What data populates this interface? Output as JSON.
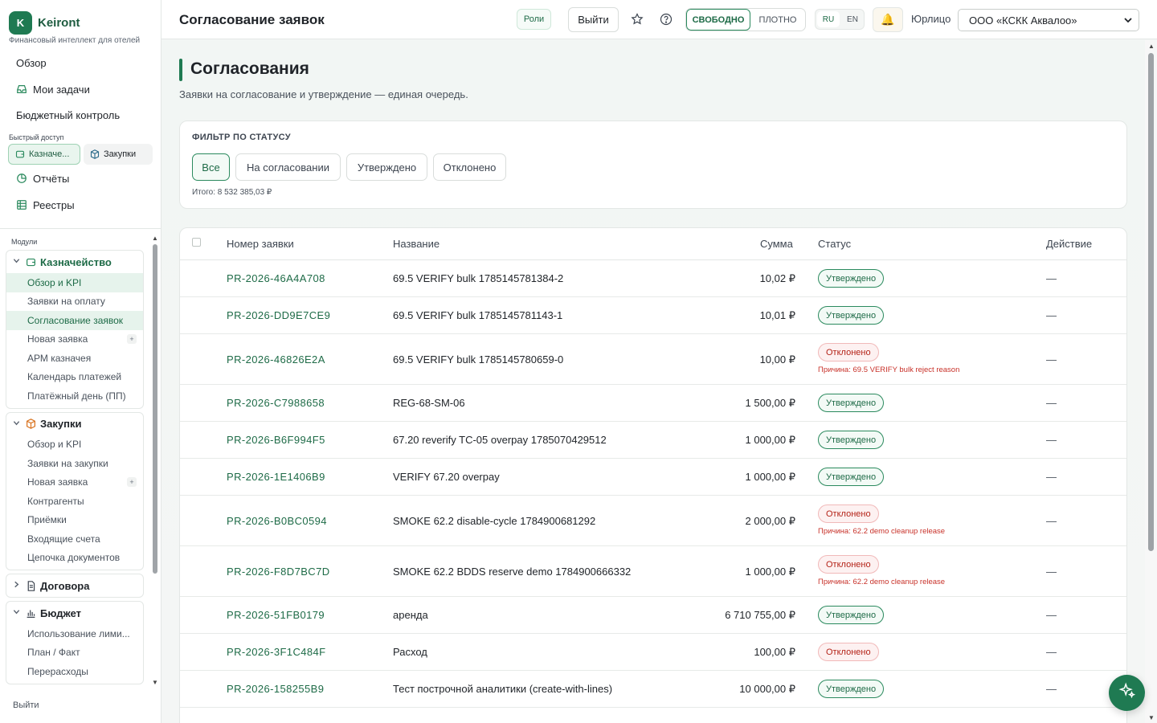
{
  "brand": {
    "logo_letter": "K",
    "name": "Keiront",
    "tagline": "Финансовый интеллект для отелей"
  },
  "sidebar": {
    "nav": [
      {
        "label": "Обзор",
        "icon": ""
      },
      {
        "label": "Мои задачи",
        "icon": "inbox-icon"
      },
      {
        "label": "Бюджетный контроль",
        "icon": ""
      }
    ],
    "quick_label": "Быстрый доступ",
    "quick": [
      {
        "label": "Казначе...",
        "icon": "wallet-icon"
      },
      {
        "label": "Закупки",
        "icon": "box-icon"
      }
    ],
    "nav2": [
      {
        "label": "Отчёты",
        "icon": "pie-chart-icon"
      },
      {
        "label": "Реестры",
        "icon": "table-icon"
      }
    ],
    "modules_label": "Модули",
    "modules": [
      {
        "title": "Казначейство",
        "icon": "wallet-icon",
        "expanded": true,
        "items": [
          {
            "label": "Обзор и KPI",
            "highlight": true
          },
          {
            "label": "Заявки на оплату"
          },
          {
            "label": "Согласование заявок",
            "highlight": true
          },
          {
            "label": "Новая заявка",
            "plus": "+"
          },
          {
            "label": "АРМ казначея"
          },
          {
            "label": "Календарь платежей"
          },
          {
            "label": "Платёжный день (ПП)"
          }
        ]
      },
      {
        "title": "Закупки",
        "icon": "box-icon",
        "expanded": true,
        "items": [
          {
            "label": "Обзор и KPI"
          },
          {
            "label": "Заявки на закупки"
          },
          {
            "label": "Новая заявка",
            "plus": "+"
          },
          {
            "label": "Контрагенты"
          },
          {
            "label": "Приёмки"
          },
          {
            "label": "Входящие счета"
          },
          {
            "label": "Цепочка документов"
          }
        ]
      },
      {
        "title": "Договора",
        "icon": "document-icon",
        "expanded": false,
        "items": []
      },
      {
        "title": "Бюджет",
        "icon": "bar-chart-icon",
        "expanded": true,
        "items": [
          {
            "label": "Использование лими..."
          },
          {
            "label": "План / Факт"
          },
          {
            "label": "Перерасходы"
          }
        ]
      }
    ],
    "logout": "Выйти"
  },
  "topbar": {
    "title": "Согласование заявок",
    "roles": "Роли",
    "exit": "Выйти",
    "density": {
      "option1": "СВОБОДНО",
      "option2": "ПЛОТНО",
      "selected": "СВОБОДНО"
    },
    "lang": {
      "ru": "RU",
      "en": "EN",
      "selected": "RU"
    },
    "entity_label": "Юрлицо",
    "entity_value": "ООО «КСКК Аквалоо»"
  },
  "main": {
    "heading": "Согласования",
    "subtitle": "Заявки на согласование и утверждение — единая очередь.",
    "filter": {
      "title": "ФИЛЬТР ПО СТАТУСУ",
      "options": [
        "Все",
        "На согласовании",
        "Утверждено",
        "Отклонено"
      ],
      "selected": "Все",
      "total": "Итого: 8 532 385,03 ₽"
    },
    "table": {
      "headers": {
        "number": "Номер заявки",
        "name": "Название",
        "amount": "Сумма",
        "status": "Статус",
        "action": "Действие"
      },
      "rows": [
        {
          "number": "PR-2026-46A4A708",
          "name": "69.5 VERIFY bulk 1785145781384-2",
          "amount": "10,02 ₽",
          "status": "Утверждено",
          "status_type": "ok",
          "reason": "",
          "action": "—"
        },
        {
          "number": "PR-2026-DD9E7CE9",
          "name": "69.5 VERIFY bulk 1785145781143-1",
          "amount": "10,01 ₽",
          "status": "Утверждено",
          "status_type": "ok",
          "reason": "",
          "action": "—"
        },
        {
          "number": "PR-2026-46826E2A",
          "name": "69.5 VERIFY bulk 1785145780659-0",
          "amount": "10,00 ₽",
          "status": "Отклонено",
          "status_type": "no",
          "reason": "Причина: 69.5 VERIFY bulk reject reason",
          "action": "—"
        },
        {
          "number": "PR-2026-C7988658",
          "name": "REG-68-SM-06",
          "amount": "1 500,00 ₽",
          "status": "Утверждено",
          "status_type": "ok",
          "reason": "",
          "action": "—"
        },
        {
          "number": "PR-2026-B6F994F5",
          "name": "67.20 reverify TC-05 overpay 1785070429512",
          "amount": "1 000,00 ₽",
          "status": "Утверждено",
          "status_type": "ok",
          "reason": "",
          "action": "—"
        },
        {
          "number": "PR-2026-1E1406B9",
          "name": "VERIFY 67.20 overpay",
          "amount": "1 000,00 ₽",
          "status": "Утверждено",
          "status_type": "ok",
          "reason": "",
          "action": "—"
        },
        {
          "number": "PR-2026-B0BC0594",
          "name": "SMOKE 62.2 disable-cycle 1784900681292",
          "amount": "2 000,00 ₽",
          "status": "Отклонено",
          "status_type": "no",
          "reason": "Причина: 62.2 demo cleanup release",
          "action": "—"
        },
        {
          "number": "PR-2026-F8D7BC7D",
          "name": "SMOKE 62.2 BDDS reserve demo 1784900666332",
          "amount": "1 000,00 ₽",
          "status": "Отклонено",
          "status_type": "no",
          "reason": "Причина: 62.2 demo cleanup release",
          "action": "—"
        },
        {
          "number": "PR-2026-51FB0179",
          "name": "аренда",
          "amount": "6 710 755,00 ₽",
          "status": "Утверждено",
          "status_type": "ok",
          "reason": "",
          "action": "—"
        },
        {
          "number": "PR-2026-3F1C484F",
          "name": "Расход",
          "amount": "100,00 ₽",
          "status": "Отклонено",
          "status_type": "no",
          "reason": "",
          "action": "—"
        },
        {
          "number": "PR-2026-158255B9",
          "name": "Тест построчной аналитики (create-with-lines)",
          "amount": "10 000,00 ₽",
          "status": "Утверждено",
          "status_type": "ok",
          "reason": "",
          "action": "—"
        }
      ]
    }
  },
  "colors": {
    "accent": "#1f7a52",
    "ok": "#1e6b47",
    "reject": "#b42318"
  }
}
